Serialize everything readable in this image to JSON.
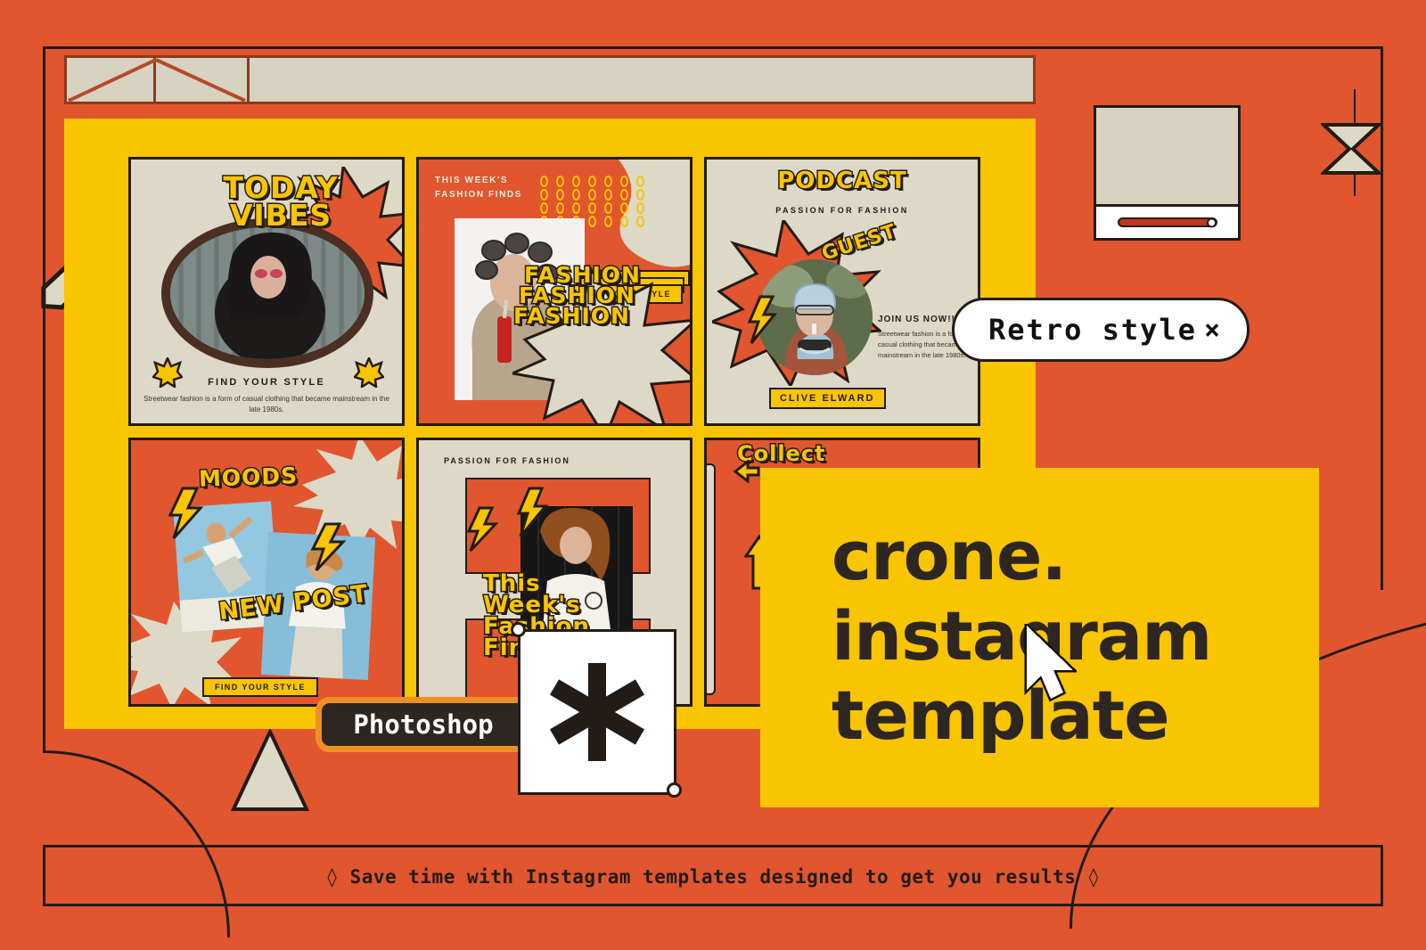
{
  "colors": {
    "background_orange": "#e1562f",
    "board_yellow": "#f9c400",
    "card_beige": "#ded8c6",
    "ink_dark": "#231c16",
    "accent_amber": "#ef8f21",
    "slider_red": "#c7341a",
    "panel_fold_dark": "#2e2621"
  },
  "chip": {
    "label": "Retro style",
    "close": "×"
  },
  "badge": {
    "label": "Photoshop"
  },
  "sticker": {
    "glyph": "✱"
  },
  "panel": {
    "line1": "crone.",
    "line2": "instagram",
    "line3": "template"
  },
  "footer": {
    "text": "◊ Save time with Instagram templates designed to get you results ◊"
  },
  "cards": [
    {
      "id": "today-vibes",
      "title_line1": "TODAY",
      "title_line2": "VIBES",
      "caption": "FIND YOUR STYLE",
      "body": "Streetwear fashion is a form of casual clothing that became mainstream in the late 1980s."
    },
    {
      "id": "fashion-finds",
      "label_line1": "THIS WEEK'S",
      "label_line2": "FASHION FINDS",
      "ribbon": "FIND YOUR STYLE",
      "title_line1": "FASHION",
      "title_line2": "FASHION",
      "title_line3": "FASHION"
    },
    {
      "id": "podcast",
      "title": "PODCAST",
      "subtitle": "PASSION FOR FASHION",
      "burst_word": "GUEST",
      "cta": "JOIN US NOW!!!",
      "body": "Streetwear fashion is a form of casual clothing that became mainstream in the late 1980s.",
      "guest_name": "CLIVE ELWARD"
    },
    {
      "id": "moods",
      "title": "MOODS",
      "subtitle": "NEW POST",
      "ribbon": "FIND YOUR STYLE"
    },
    {
      "id": "this-weeks-fashion-finds",
      "label": "PASSION FOR FASHION",
      "title_line1": "This",
      "title_line2": "Week's",
      "title_line3": "Fashion",
      "title_line4": "Finds"
    },
    {
      "id": "collect",
      "title": "Collect"
    }
  ],
  "icons": {
    "pencil": "pencil-icon",
    "hourglass": "hourglass-icon",
    "slider": "slider-control",
    "cursor": "mouse-cursor-icon",
    "triangle": "triangle-shape",
    "asterisk": "asterisk-icon"
  }
}
